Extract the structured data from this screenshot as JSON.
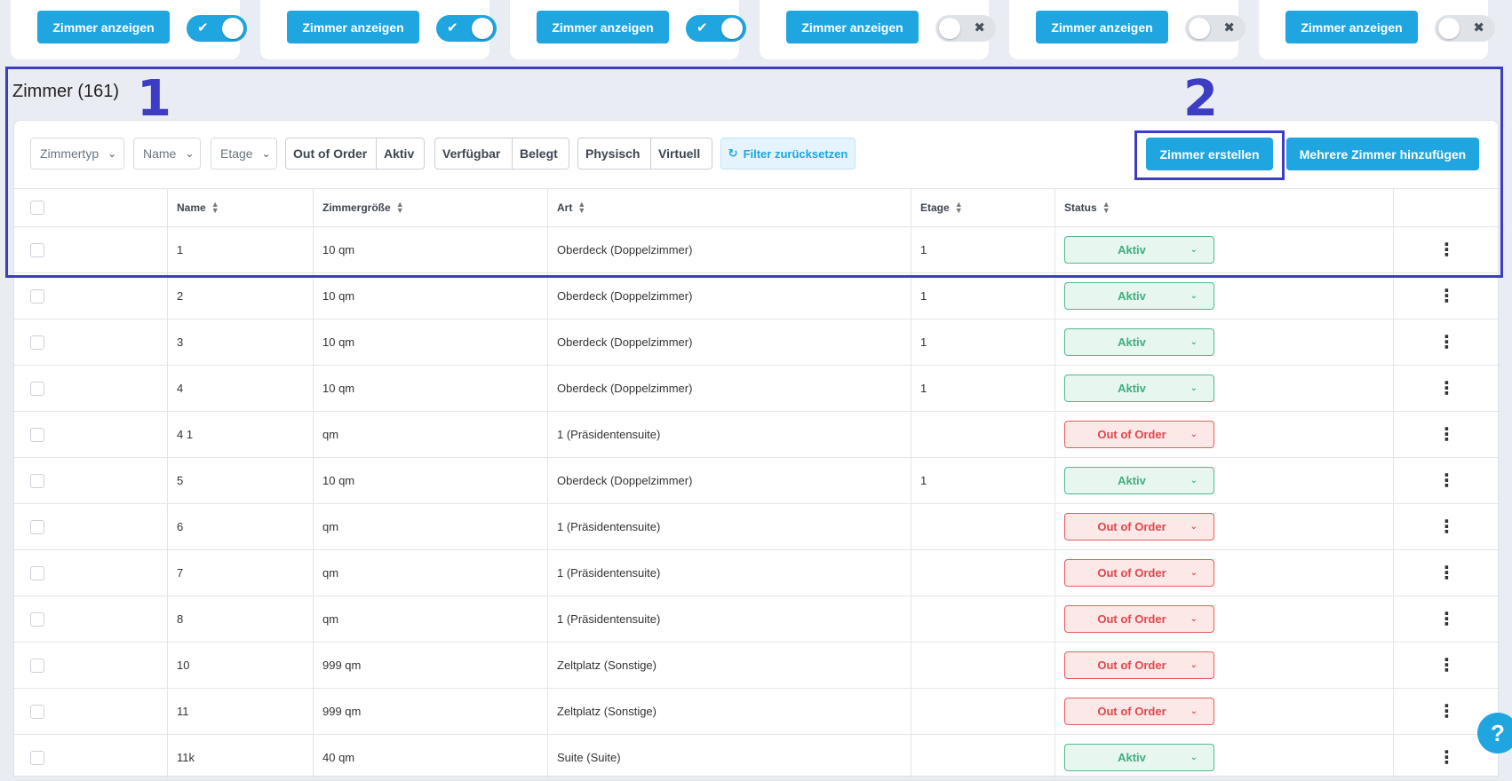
{
  "top_cards": [
    {
      "button_label": "Zimmer anzeigen",
      "toggle_on": true,
      "toggle_mark": "✔"
    },
    {
      "button_label": "Zimmer anzeigen",
      "toggle_on": true,
      "toggle_mark": "✔"
    },
    {
      "button_label": "Zimmer anzeigen",
      "toggle_on": true,
      "toggle_mark": "✔"
    },
    {
      "button_label": "Zimmer anzeigen",
      "toggle_on": false,
      "toggle_mark": "✖"
    },
    {
      "button_label": "Zimmer anzeigen",
      "toggle_on": false,
      "toggle_mark": "✖"
    },
    {
      "button_label": "Zimmer anzeigen",
      "toggle_on": false,
      "toggle_mark": "✖"
    }
  ],
  "annotations": {
    "one": "1",
    "two": "2"
  },
  "section": {
    "title": "Zimmer (161)"
  },
  "toolbar": {
    "filters": [
      "Zimmertyp",
      "Name",
      "Etage"
    ],
    "segment_status": [
      "Out of Order",
      "Aktiv"
    ],
    "segment_availability": [
      "Verfügbar",
      "Belegt"
    ],
    "segment_type": [
      "Physisch",
      "Virtuell"
    ],
    "reset_label": "Filter zurücksetzen",
    "create_label": "Zimmer erstellen",
    "add_multiple_label": "Mehrere Zimmer hinzufügen"
  },
  "table": {
    "headers": [
      "Name",
      "Zimmergröße",
      "Art",
      "Etage",
      "Status"
    ],
    "rows": [
      {
        "name": "1",
        "size": "10 qm",
        "type": "Oberdeck (Doppelzimmer)",
        "floor": "1",
        "status": "Aktiv"
      },
      {
        "name": "2",
        "size": "10 qm",
        "type": "Oberdeck (Doppelzimmer)",
        "floor": "1",
        "status": "Aktiv"
      },
      {
        "name": "3",
        "size": "10 qm",
        "type": "Oberdeck (Doppelzimmer)",
        "floor": "1",
        "status": "Aktiv"
      },
      {
        "name": "4",
        "size": "10 qm",
        "type": "Oberdeck (Doppelzimmer)",
        "floor": "1",
        "status": "Aktiv"
      },
      {
        "name": "4 1",
        "size": "qm",
        "type": "1 (Präsidentensuite)",
        "floor": "",
        "status": "Out of Order"
      },
      {
        "name": "5",
        "size": "10 qm",
        "type": "Oberdeck (Doppelzimmer)",
        "floor": "1",
        "status": "Aktiv"
      },
      {
        "name": "6",
        "size": "qm",
        "type": "1 (Präsidentensuite)",
        "floor": "",
        "status": "Out of Order"
      },
      {
        "name": "7",
        "size": "qm",
        "type": "1 (Präsidentensuite)",
        "floor": "",
        "status": "Out of Order"
      },
      {
        "name": "8",
        "size": "qm",
        "type": "1 (Präsidentensuite)",
        "floor": "",
        "status": "Out of Order"
      },
      {
        "name": "10",
        "size": "999 qm",
        "type": "Zeltplatz (Sonstige)",
        "floor": "",
        "status": "Out of Order"
      },
      {
        "name": "11",
        "size": "999 qm",
        "type": "Zeltplatz (Sonstige)",
        "floor": "",
        "status": "Out of Order"
      },
      {
        "name": "11k",
        "size": "40 qm",
        "type": "Suite (Suite)",
        "floor": "",
        "status": "Aktiv"
      }
    ]
  },
  "help_label": "?",
  "colors": {
    "accent": "#1fa5e0",
    "annotation": "#3c3dc4",
    "active": "#3fae7e",
    "out_of_order": "#e0474c"
  }
}
